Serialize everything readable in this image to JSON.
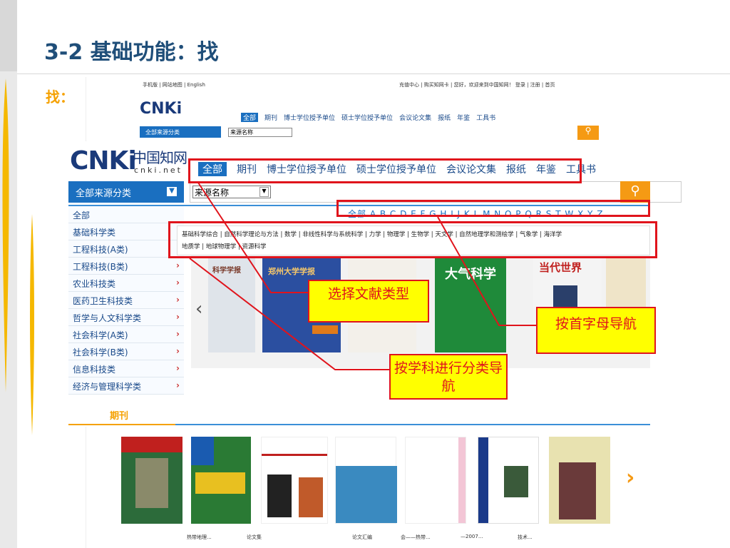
{
  "slide": {
    "title": "3-2 基础功能：找",
    "lead": "找："
  },
  "bg_screenshot": {
    "top_left": "手机版 | 网站地图 | English",
    "top_right": "充值中心 | 购买知网卡 | 您好，欢迎来到中国知网！ 登录 | 注册 | 首页",
    "logo": "CNKi",
    "nav": [
      "全部",
      "期刊",
      "博士学位授予单位",
      "硕士学位授予单位",
      "会议论文集",
      "报纸",
      "年鉴",
      "工具书"
    ],
    "source_label": "全部来源分类",
    "source_select": "来源名称",
    "footer_items": [
      "热带地理...",
      "论文集",
      "论文汇编",
      "会——热带...",
      "—2007...",
      "技术..."
    ]
  },
  "cnki": {
    "logo_mark": "CNKi",
    "logo_cn": "中国知网",
    "logo_en": "cnki.net",
    "nav": [
      "全部",
      "期刊",
      "博士学位授予单位",
      "硕士学位授予单位",
      "会议论文集",
      "报纸",
      "年鉴",
      "工具书"
    ],
    "source_label": "全部来源分类",
    "source_select": "来源名称",
    "alphabet": "全部 A B C D E F G H I J K L M N O P Q R S T W X Y Z",
    "sidebar": [
      "全部",
      "基础科学类",
      "工程科技(A类)",
      "工程科技(B类)",
      "农业科技类",
      "医药卫生科技类",
      "哲学与人文科学类",
      "社会科学(A类)",
      "社会科学(B类)",
      "信息科技类",
      "经济与管理科学类"
    ],
    "subjects_line1": "基础科学综合 | 自然科学理论与方法 | 数学 | 非线性科学与系统科学 | 力学 | 物理学 | 生物学 | 天文学 | 自然地理学和测绘学 | 气象学 | 海洋学",
    "subjects_line2": "地质学 | 地球物理学 | 资源科学",
    "journal_section": "期刊",
    "cover_titles": [
      "科学学报",
      "郑州大学学报",
      "大气科学",
      "当代世界"
    ]
  },
  "callouts": {
    "type": "选择文献类型",
    "alpha": "按首字母导航",
    "subject": "按学科进行分类导航"
  },
  "colors": {
    "title": "#1f4e79",
    "accent": "#f5a100",
    "cnki_blue": "#1a6fc0",
    "annotation_red": "#e0141c",
    "callout_yellow": "#ffff00"
  }
}
